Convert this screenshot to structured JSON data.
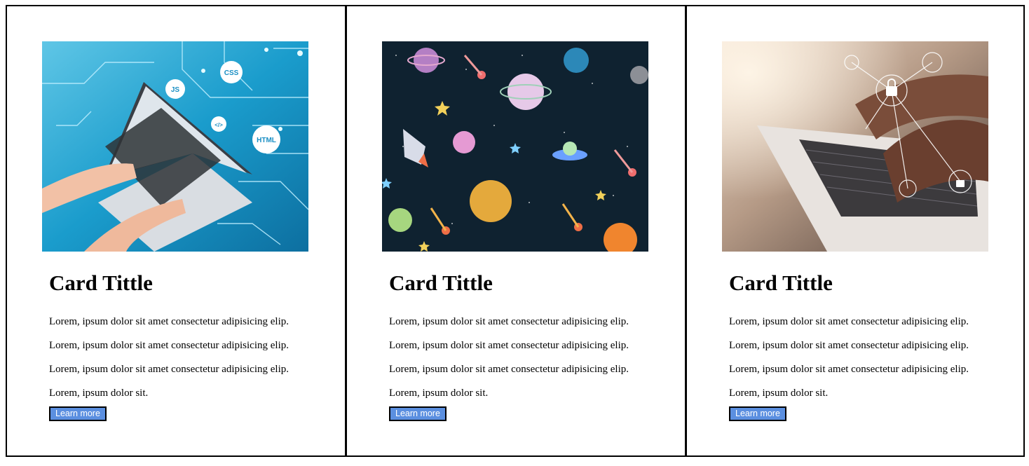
{
  "cards": [
    {
      "image_subject": "laptop-coding-image",
      "title": "Card Tittle",
      "lines": [
        "Lorem, ipsum dolor sit amet consectetur adipisicing elip.",
        "Lorem, ipsum dolor sit amet consectetur adipisicing elip.",
        "Lorem, ipsum dolor sit amet consectetur adipisicing elip.",
        "Lorem, ipsum dolor sit."
      ],
      "button_label": "Learn more",
      "image_labels": [
        "JS",
        "CSS",
        "</>",
        "HTML"
      ]
    },
    {
      "image_subject": "space-planets-image",
      "title": "Card Tittle",
      "lines": [
        "Lorem, ipsum dolor sit amet consectetur adipisicing elip.",
        "Lorem, ipsum dolor sit amet consectetur adipisicing elip.",
        "Lorem, ipsum dolor sit amet consectetur adipisicing elip.",
        "Lorem, ipsum dolor sit."
      ],
      "button_label": "Learn more"
    },
    {
      "image_subject": "laptop-security-image",
      "title": "Card Tittle",
      "lines": [
        "Lorem, ipsum dolor sit amet consectetur adipisicing elip.",
        "Lorem, ipsum dolor sit amet consectetur adipisicing elip.",
        "Lorem, ipsum dolor sit amet consectetur adipisicing elip.",
        "Lorem, ipsum dolor sit."
      ],
      "button_label": "Learn more"
    }
  ],
  "colors": {
    "button_bg": "#5b8fe0",
    "button_text": "#ffffff",
    "border": "#000000",
    "space_bg": "#0f2230",
    "tech_blue": "#1a8fc4"
  }
}
